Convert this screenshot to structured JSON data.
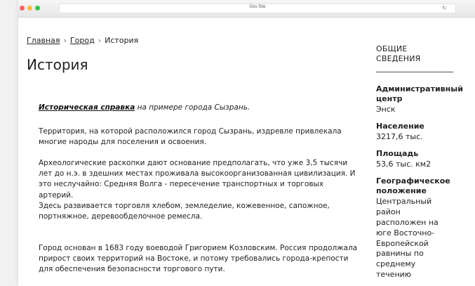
{
  "browser": {
    "address_text": "Gos Site"
  },
  "breadcrumb": {
    "items": [
      "Главная",
      "Город",
      "История"
    ],
    "separator": "›"
  },
  "page": {
    "title": "История"
  },
  "article": {
    "intro_link": "Историческая справка",
    "intro_rest": "на примере города Сызрань.",
    "paragraphs": [
      "Территория, на которой расположился город Сызрань, издревле привлекала многие народы для поселения и освоения.",
      "Археологические раскопки дают основание предполагать, что уже 3,5 тысячи лет до н.э. в здешних местах проживала высокоорганизованная цивилизация. И это неслучайно: Средняя Волга - пересечение транспортных и торговых артерий.",
      "Здесь развивается торговля хлебом, земледелие, кожевенное, сапожное, портняжное, деревообделочное ремесла.",
      "Город основан в 1683 году воеводой Григорием Козловским. Россия продолжала прирост своих территорий на Востоке, и потому требовались города-крепости для обеспечения безопасности торгового пути."
    ]
  },
  "sidebar": {
    "title": "Общие сведения",
    "facts": [
      {
        "label": "Административный центр",
        "value": "Энск"
      },
      {
        "label": "Население",
        "value": "3217,6 тыс."
      },
      {
        "label": "Площадь",
        "value": "53,6 тыс. км2"
      },
      {
        "label": "Географическое положение",
        "value": "Центральный район расположен на юге Восточно-Европейской равнины по среднему течению"
      }
    ]
  }
}
